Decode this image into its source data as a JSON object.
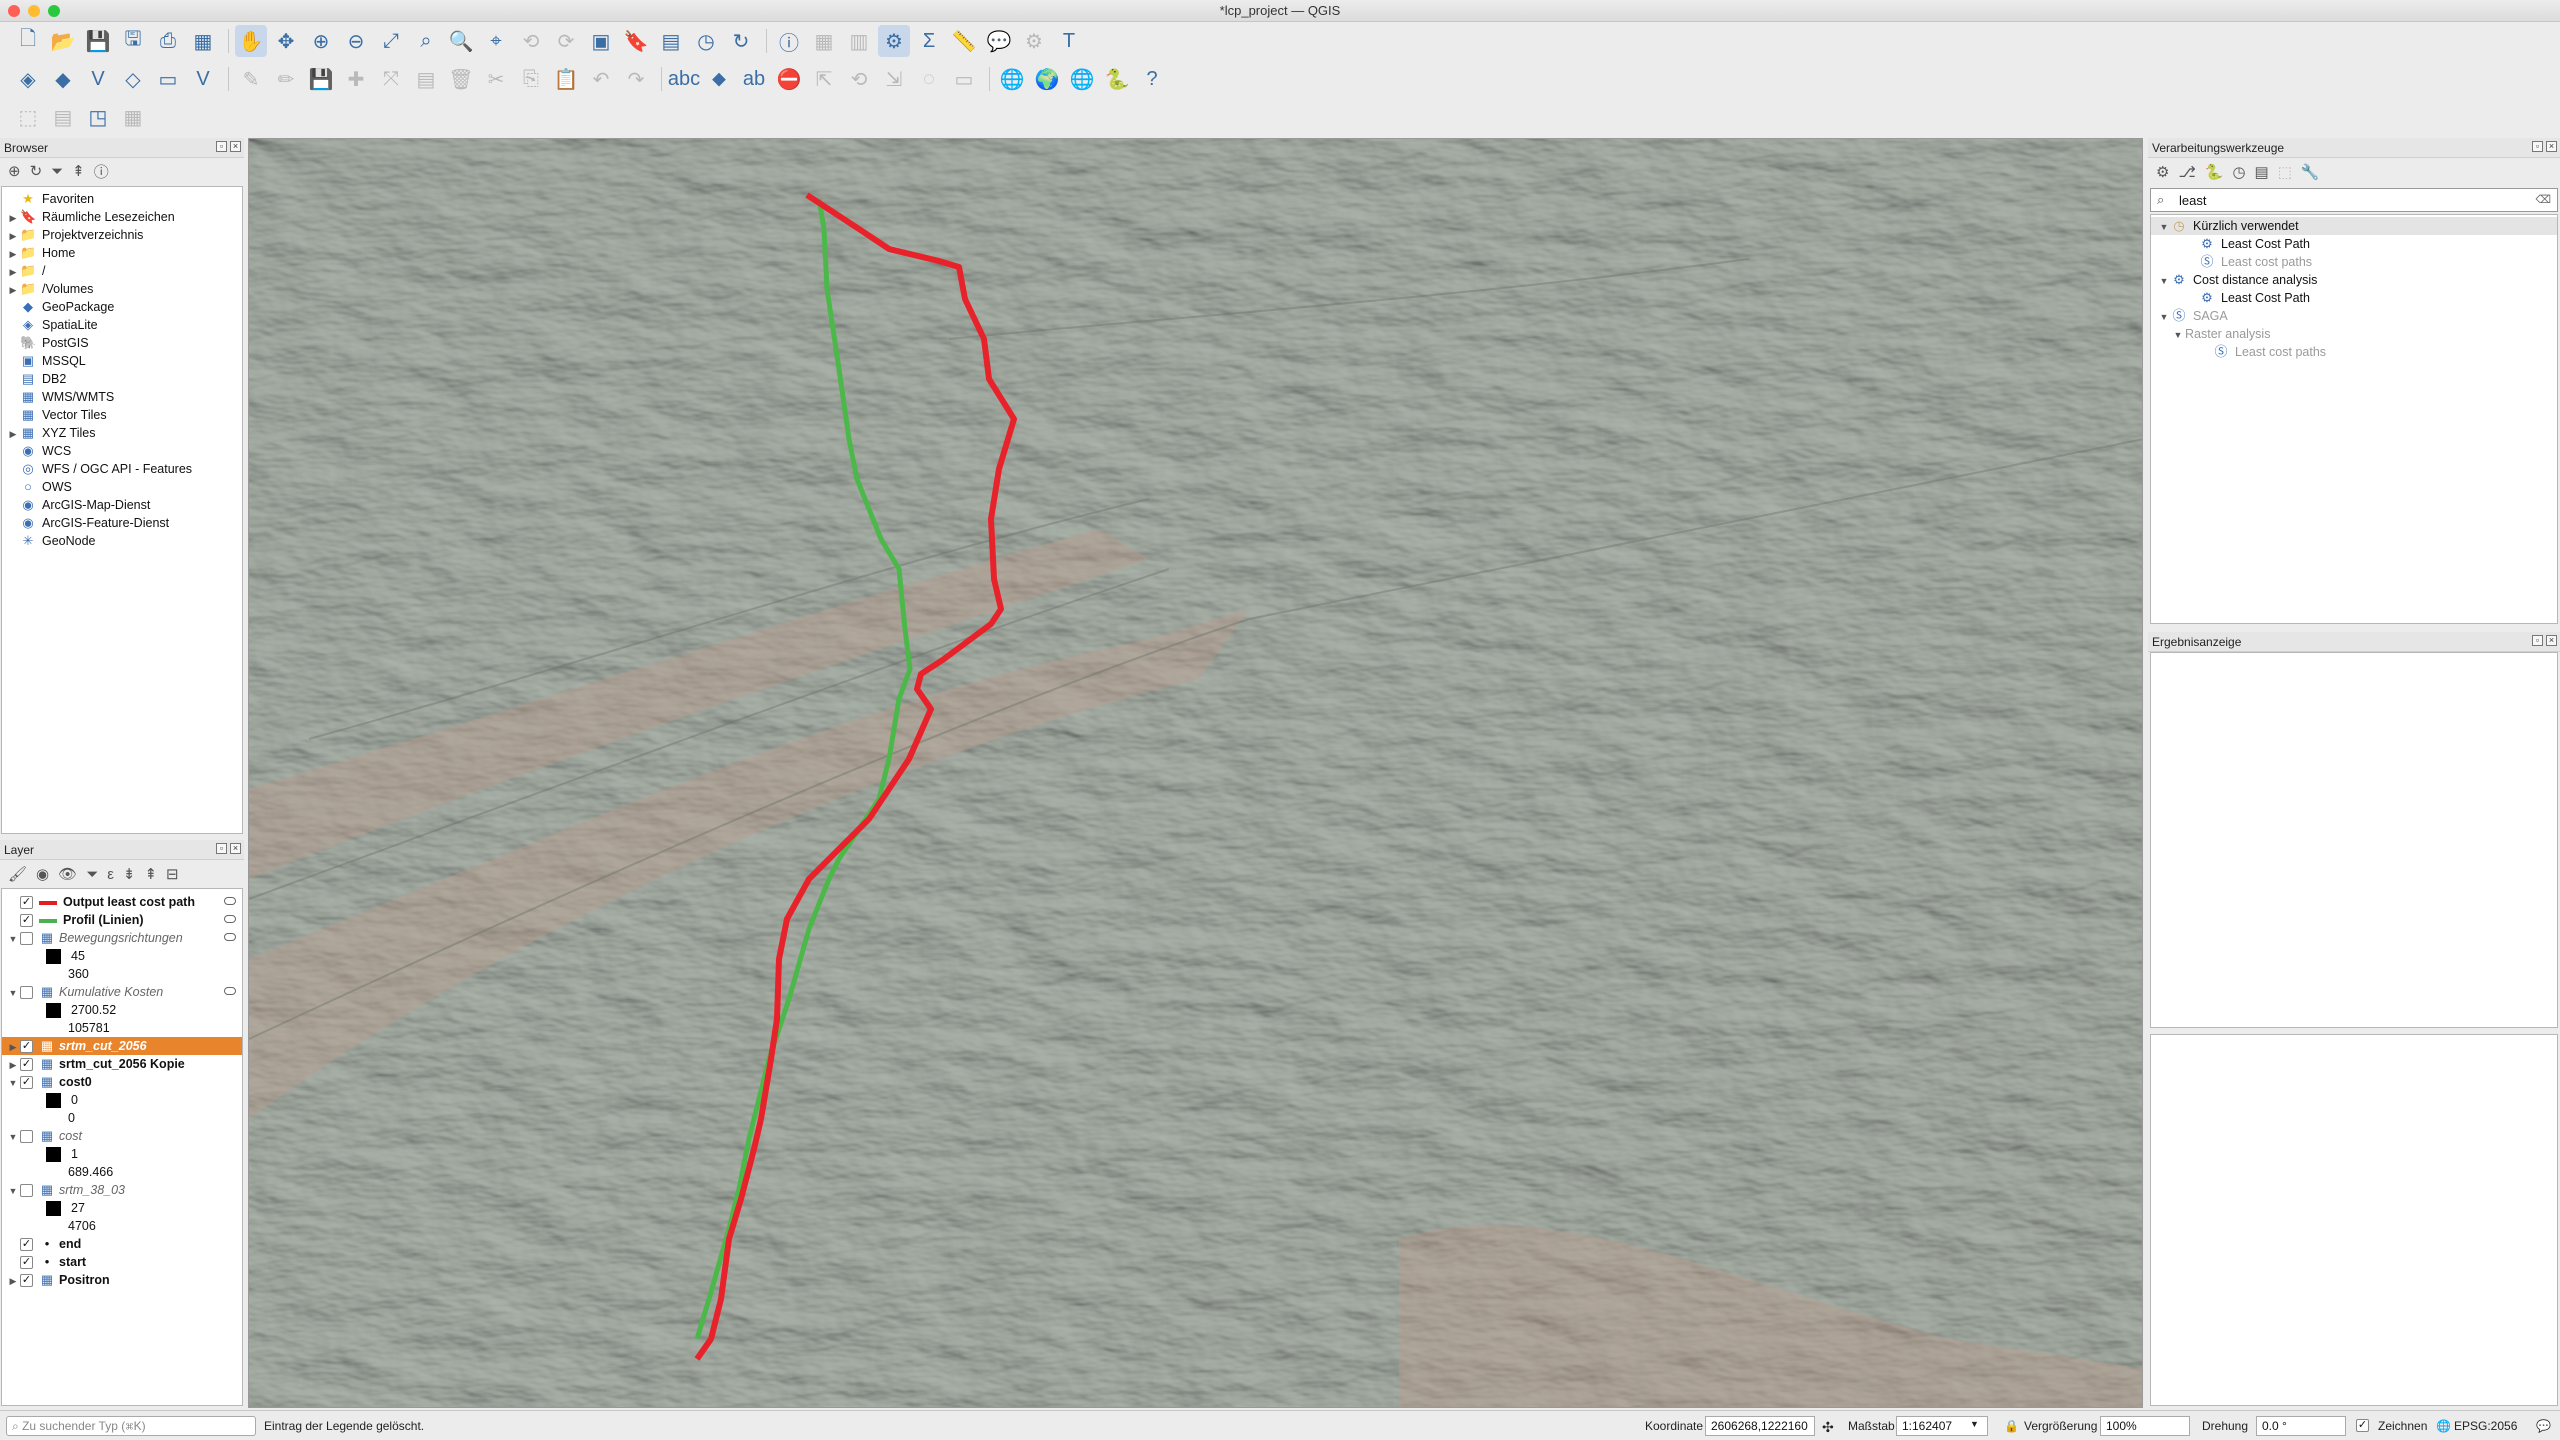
{
  "window": {
    "title": "*lcp_project — QGIS"
  },
  "browser": {
    "title": "Browser",
    "items": [
      {
        "label": "Favoriten",
        "icon": "star-icon",
        "arrow": ""
      },
      {
        "label": "Räumliche Lesezeichen",
        "icon": "bookmark-icon",
        "arrow": "▶"
      },
      {
        "label": "Projektverzeichnis",
        "icon": "folder-icon",
        "arrow": "▶"
      },
      {
        "label": "Home",
        "icon": "folder-icon",
        "arrow": "▶"
      },
      {
        "label": "/",
        "icon": "folder-icon",
        "arrow": "▶"
      },
      {
        "label": "/Volumes",
        "icon": "folder-icon",
        "arrow": "▶"
      },
      {
        "label": "GeoPackage",
        "icon": "geopackage-icon",
        "arrow": ""
      },
      {
        "label": "SpatiaLite",
        "icon": "spatialite-icon",
        "arrow": ""
      },
      {
        "label": "PostGIS",
        "icon": "postgis-icon",
        "arrow": ""
      },
      {
        "label": "MSSQL",
        "icon": "mssql-icon",
        "arrow": ""
      },
      {
        "label": "DB2",
        "icon": "db2-icon",
        "arrow": ""
      },
      {
        "label": "WMS/WMTS",
        "icon": "wms-icon",
        "arrow": ""
      },
      {
        "label": "Vector Tiles",
        "icon": "vector-tiles-icon",
        "arrow": ""
      },
      {
        "label": "XYZ Tiles",
        "icon": "xyz-tiles-icon",
        "arrow": "▶"
      },
      {
        "label": "WCS",
        "icon": "wcs-icon",
        "arrow": ""
      },
      {
        "label": "WFS / OGC API - Features",
        "icon": "wfs-icon",
        "arrow": ""
      },
      {
        "label": "OWS",
        "icon": "ows-icon",
        "arrow": ""
      },
      {
        "label": "ArcGIS-Map-Dienst",
        "icon": "arcgis-icon",
        "arrow": ""
      },
      {
        "label": "ArcGIS-Feature-Dienst",
        "icon": "arcgis-icon",
        "arrow": ""
      },
      {
        "label": "GeoNode",
        "icon": "geonode-icon",
        "arrow": ""
      }
    ]
  },
  "layers": {
    "title": "Layer",
    "items": [
      {
        "label": "Output least cost path",
        "kind": "line",
        "color": "#e02020",
        "checked": true,
        "bold": true
      },
      {
        "label": "Profil (Linien)",
        "kind": "line",
        "color": "#4caf50",
        "checked": true,
        "bold": true
      },
      {
        "label": "Bewegungsrichtungen",
        "kind": "raster",
        "checked": false,
        "italic": true,
        "arrow": "▼"
      },
      {
        "label": "45",
        "kind": "legend-swatch"
      },
      {
        "label": "360",
        "kind": "legend-text"
      },
      {
        "label": "Kumulative Kosten",
        "kind": "raster",
        "checked": false,
        "italic": true,
        "arrow": "▼"
      },
      {
        "label": "2700.52",
        "kind": "legend-swatch"
      },
      {
        "label": "105781",
        "kind": "legend-text"
      },
      {
        "label": "srtm_cut_2056",
        "kind": "raster",
        "checked": true,
        "selected": true,
        "arrow": "▶"
      },
      {
        "label": "srtm_cut_2056 Kopie",
        "kind": "raster",
        "checked": true,
        "bold": true,
        "arrow": "▶"
      },
      {
        "label": "cost0",
        "kind": "raster",
        "checked": true,
        "bold": true,
        "arrow": "▼"
      },
      {
        "label": "0",
        "kind": "legend-swatch"
      },
      {
        "label": "0",
        "kind": "legend-text"
      },
      {
        "label": "cost",
        "kind": "raster",
        "checked": false,
        "italic": true,
        "arrow": "▼"
      },
      {
        "label": "1",
        "kind": "legend-swatch"
      },
      {
        "label": "689.466",
        "kind": "legend-text"
      },
      {
        "label": "srtm_38_03",
        "kind": "raster",
        "checked": false,
        "italic": true,
        "arrow": "▼"
      },
      {
        "label": "27",
        "kind": "legend-swatch"
      },
      {
        "label": "4706",
        "kind": "legend-text"
      },
      {
        "label": "end",
        "kind": "point",
        "checked": true,
        "bold": true
      },
      {
        "label": "start",
        "kind": "point",
        "checked": true,
        "bold": true
      },
      {
        "label": "Positron",
        "kind": "raster",
        "checked": true,
        "bold": true,
        "arrow": "▶"
      }
    ]
  },
  "processing": {
    "title": "Verarbeitungswerkzeuge",
    "search_value": "least",
    "tree": [
      {
        "label": "Kürzlich verwendet",
        "level": 0,
        "arrow": "▼",
        "icon": "clock-icon",
        "dim": false,
        "highlight": true
      },
      {
        "label": "Least Cost Path",
        "level": 2,
        "arrow": "",
        "icon": "gear-icon",
        "dim": false
      },
      {
        "label": "Least cost paths",
        "level": 2,
        "arrow": "",
        "icon": "saga-icon",
        "dim": true
      },
      {
        "label": "Cost distance analysis",
        "level": 0,
        "arrow": "▼",
        "icon": "gear-icon",
        "dim": false
      },
      {
        "label": "Least Cost Path",
        "level": 2,
        "arrow": "",
        "icon": "gear-icon",
        "dim": false
      },
      {
        "label": "SAGA",
        "level": 0,
        "arrow": "▼",
        "icon": "saga-icon",
        "dim": true
      },
      {
        "label": "Raster analysis",
        "level": 1,
        "arrow": "▼",
        "icon": "",
        "dim": true
      },
      {
        "label": "Least cost paths",
        "level": 3,
        "arrow": "",
        "icon": "saga-icon",
        "dim": true
      }
    ]
  },
  "results": {
    "title": "Ergebnisanzeige"
  },
  "status": {
    "search_placeholder": "Zu suchender Typ (⌘K)",
    "message": "Eintrag der Legende gelöscht.",
    "coord_label": "Koordinate",
    "coord_value": "2606268,1222160",
    "scale_label": "Maßstab",
    "scale_value": "1:162407",
    "magnifier_label": "Vergrößerung",
    "magnifier_value": "100%",
    "rotation_label": "Drehung",
    "rotation_value": "0.0 °",
    "render_label": "Zeichnen",
    "crs": "EPSG:2056"
  },
  "map": {
    "red_path_color": "#e8222a",
    "green_path_color": "#4cb84a"
  }
}
